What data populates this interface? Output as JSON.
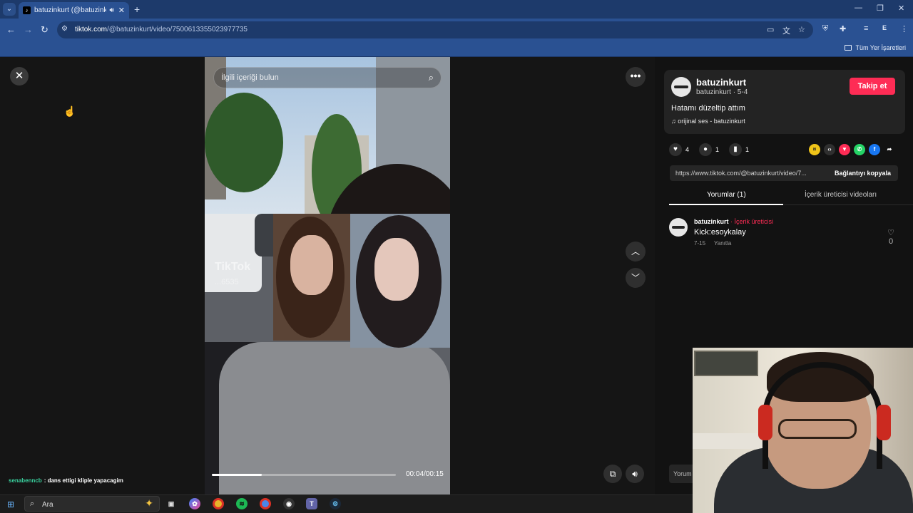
{
  "browser": {
    "tab_title": "batuzinkurt (@batuzinkurt)",
    "tab_sound_icon": "speaker-icon",
    "url_domain": "tiktok.com",
    "url_path": "/@batuzinkurt/video/7500613355023977735",
    "profile_letter": "E",
    "bookmarks_all": "Tüm Yer İşaretleri"
  },
  "video": {
    "search_placeholder": "İlgili içeriği bulun",
    "watermark": "TikTok",
    "watermark_id": "...6535",
    "time": "00:04/00:15",
    "progress_fraction": 0.27
  },
  "stream_chat": {
    "user": "senabenncb",
    "message": ": dans ettigi kliple yapacagim"
  },
  "post": {
    "username": "batuzinkurt",
    "subline": "batuzinkurt · 5-4",
    "follow_label": "Takip et",
    "description": "Hatamı düzeltip attım",
    "music": "orijinal ses - batuzinkurt",
    "likes": "4",
    "comments": "1",
    "saves": "1",
    "link": "https://www.tiktok.com/@batuzinkurt/video/7...",
    "copy_label": "Bağlantıyı kopyala"
  },
  "tabs": {
    "comments": "Yorumlar (1)",
    "creator_videos": "İçerik üreticisi videoları"
  },
  "comment": {
    "user": "batuzinkurt",
    "badge": " · İçerik üreticisi",
    "text": "Kick:esoykalay",
    "date": "7-15",
    "reply": "Yanıtla",
    "likes": "0"
  },
  "comment_input_placeholder": "Yorum",
  "taskbar": {
    "search_placeholder": "Ara"
  },
  "colors": {
    "tiktok_red": "#fe2c55",
    "chrome_blue": "#2a5192"
  }
}
